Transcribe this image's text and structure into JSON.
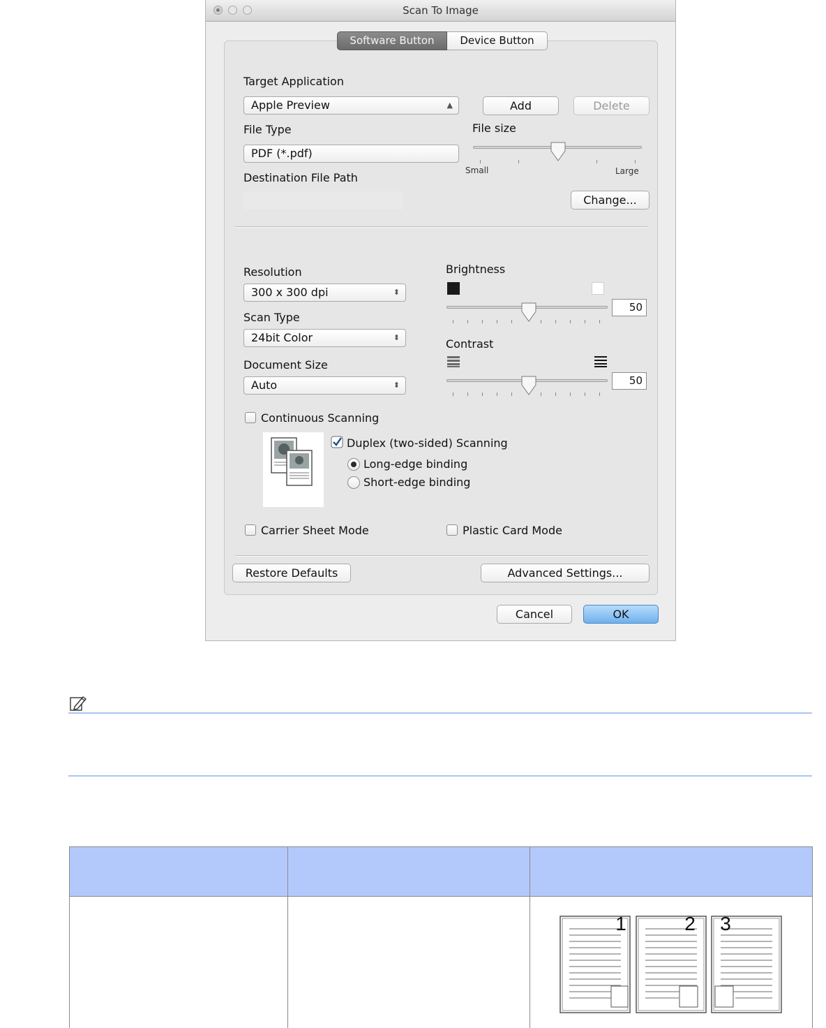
{
  "window": {
    "title": "Scan To Image",
    "tabs": [
      {
        "label": "Software Button",
        "selected": true
      },
      {
        "label": "Device Button",
        "selected": false
      }
    ]
  },
  "target_app": {
    "label": "Target Application",
    "value": "Apple Preview",
    "add_label": "Add",
    "delete_label": "Delete"
  },
  "file_type": {
    "label": "File Type",
    "value": "PDF (*.pdf)"
  },
  "file_size": {
    "label": "File size",
    "small_label": "Small",
    "large_label": "Large",
    "level": 0.5
  },
  "destination": {
    "label": "Destination File Path",
    "value": "",
    "change_label": "Change..."
  },
  "resolution": {
    "label": "Resolution",
    "value": "300 x 300 dpi"
  },
  "scan_type": {
    "label": "Scan Type",
    "value": "24bit Color"
  },
  "document_size": {
    "label": "Document Size",
    "value": "Auto"
  },
  "brightness": {
    "label": "Brightness",
    "value": "50"
  },
  "contrast": {
    "label": "Contrast",
    "value": "50"
  },
  "continuous": {
    "label": "Continuous Scanning",
    "checked": false
  },
  "duplex": {
    "label": "Duplex (two-sided) Scanning",
    "checked": true,
    "long_edge": "Long-edge binding",
    "short_edge": "Short-edge binding",
    "selected": "long_edge"
  },
  "carrier": {
    "label": "Carrier Sheet Mode",
    "checked": false
  },
  "plastic": {
    "label": "Plastic Card Mode",
    "checked": false
  },
  "footer": {
    "restore_label": "Restore Defaults",
    "advanced_label": "Advanced Settings...",
    "cancel_label": "Cancel",
    "ok_label": "OK"
  },
  "figure": {
    "page_numbers": [
      "1",
      "2",
      "3"
    ]
  },
  "colors": {
    "rule_blue": "#a8c6f4",
    "table_header": "#b4c9fb",
    "ok_button": "#6fb1ee"
  }
}
